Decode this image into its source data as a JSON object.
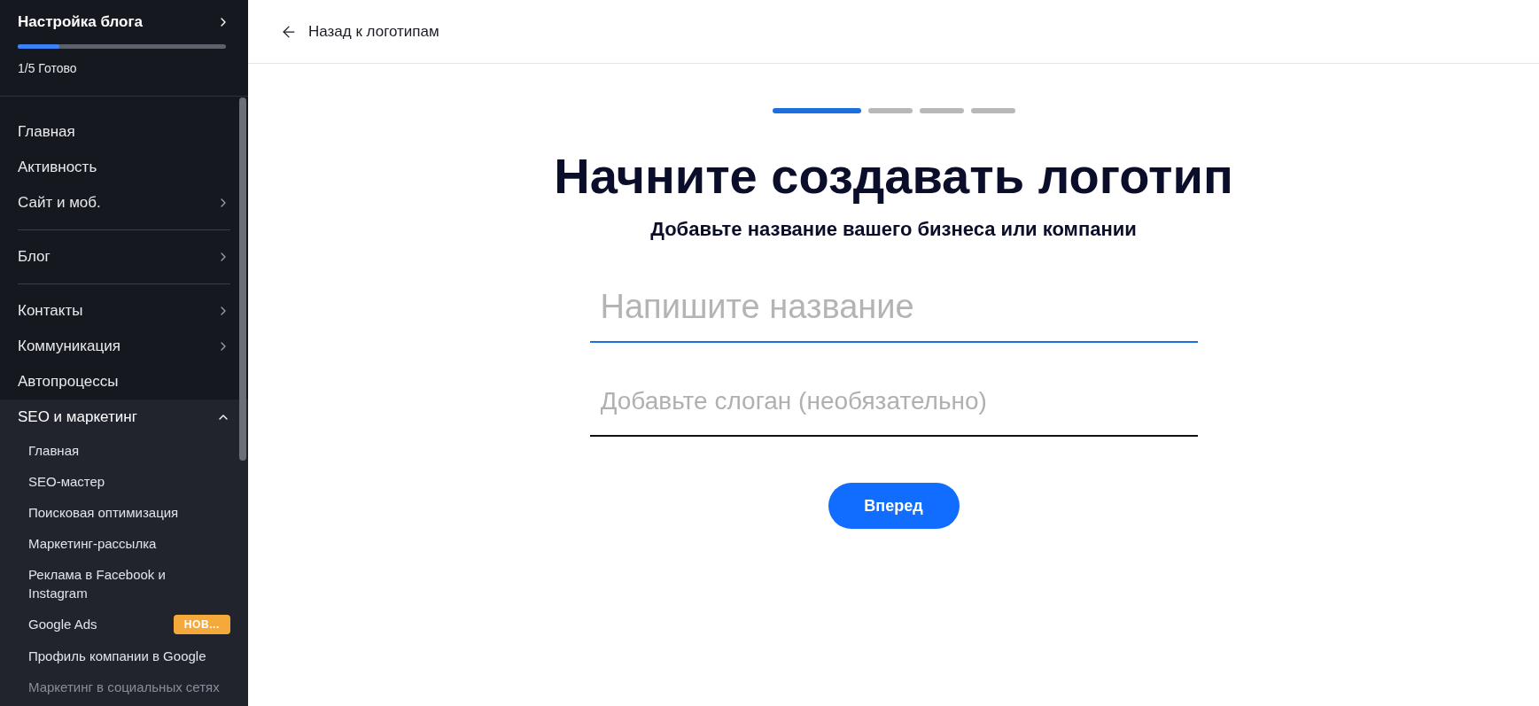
{
  "sidebar": {
    "setup": {
      "title": "Настройка блога",
      "level": 0.2,
      "status": "1/5 Готово"
    },
    "groups": [
      {
        "items": [
          {
            "label": "Главная",
            "kind": "link"
          },
          {
            "label": "Активность",
            "kind": "link"
          },
          {
            "label": "Сайт и моб.",
            "kind": "menu",
            "expanded": false
          }
        ]
      },
      {
        "items": [
          {
            "label": "Блог",
            "kind": "menu",
            "expanded": false
          }
        ]
      },
      {
        "items": [
          {
            "label": "Контакты",
            "kind": "menu",
            "expanded": false
          },
          {
            "label": "Коммуникация",
            "kind": "menu",
            "expanded": false
          },
          {
            "label": "Автопроцессы",
            "kind": "link"
          },
          {
            "label": "SEO и маркетинг",
            "kind": "menu",
            "expanded": true,
            "children": [
              {
                "label": "Главная",
                "faded": false
              },
              {
                "label": "SEO-мастер",
                "faded": false
              },
              {
                "label": "Поисковая оптимизация",
                "faded": false
              },
              {
                "label": "Маркетинг-рассылка",
                "faded": false
              },
              {
                "label": "Реклама в Facebook и Instagram",
                "faded": false
              },
              {
                "label": "Google Ads",
                "badge": "НОВ...",
                "faded": false
              },
              {
                "label": "Профиль компании в Google",
                "faded": false
              },
              {
                "label": "Маркетинг в социальных сетях",
                "faded": true
              }
            ]
          }
        ]
      }
    ]
  },
  "header": {
    "back_link": "Назад к логотипам"
  },
  "wizard": {
    "steps": [
      {
        "selected": true
      },
      {
        "selected": false
      },
      {
        "selected": false
      },
      {
        "selected": false
      }
    ],
    "title": "Начните создавать логотип",
    "subtitle": "Добавьте название вашего бизнеса или компании",
    "fields": [
      {
        "placeholder": "Напишите название",
        "focused": true,
        "kind": "large"
      },
      {
        "placeholder": "Добавьте слоган (необязательно)",
        "focused": false,
        "kind": "small"
      }
    ],
    "next_button": "Вперед"
  }
}
